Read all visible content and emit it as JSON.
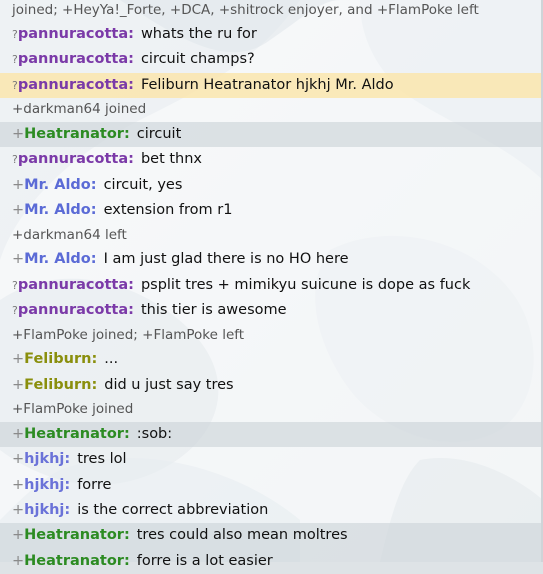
{
  "theme": {
    "pannuracotta": "#7b3aa8",
    "heatranator": "#2c8b22",
    "mraldo": "#5b6bd6",
    "feliburn": "#8a8f0d",
    "hjkhj": "#6a72d8"
  },
  "log": [
    {
      "kind": "sys",
      "text": "joined; +HeyYa!_Forte, +DCA, +shitrock enjoyer, and +FlamPoke left",
      "cls": "top"
    },
    {
      "kind": "msg",
      "rank": "?",
      "user": "pannuracotta",
      "colorKey": "pannuracotta",
      "text": "whats the ru for"
    },
    {
      "kind": "msg",
      "rank": "?",
      "user": "pannuracotta",
      "colorKey": "pannuracotta",
      "text": "circuit champs?"
    },
    {
      "kind": "msg",
      "rank": "?",
      "user": "pannuracotta",
      "colorKey": "pannuracotta",
      "text": "Feliburn Heatranator hjkhj Mr. Aldo",
      "highlight": true
    },
    {
      "kind": "sys",
      "text": "+darkman64 joined"
    },
    {
      "kind": "msg",
      "rank": "+",
      "user": "Heatranator",
      "colorKey": "heatranator",
      "text": "circuit",
      "gray": true
    },
    {
      "kind": "msg",
      "rank": "?",
      "user": "pannuracotta",
      "colorKey": "pannuracotta",
      "text": "bet thnx"
    },
    {
      "kind": "msg",
      "rank": "+",
      "user": "Mr. Aldo",
      "colorKey": "mraldo",
      "text": "circuit, yes"
    },
    {
      "kind": "msg",
      "rank": "+",
      "user": "Mr. Aldo",
      "colorKey": "mraldo",
      "text": "extension from r1"
    },
    {
      "kind": "sys",
      "text": "+darkman64 left"
    },
    {
      "kind": "msg",
      "rank": "+",
      "user": "Mr. Aldo",
      "colorKey": "mraldo",
      "text": "I am just glad there is no HO here"
    },
    {
      "kind": "msg",
      "rank": "?",
      "user": "pannuracotta",
      "colorKey": "pannuracotta",
      "text": "psplit tres + mimikyu suicune is dope as fuck"
    },
    {
      "kind": "msg",
      "rank": "?",
      "user": "pannuracotta",
      "colorKey": "pannuracotta",
      "text": "this tier is awesome"
    },
    {
      "kind": "sys",
      "text": "+FlamPoke joined; +FlamPoke left"
    },
    {
      "kind": "msg",
      "rank": "+",
      "user": "Feliburn",
      "colorKey": "feliburn",
      "text": "..."
    },
    {
      "kind": "msg",
      "rank": "+",
      "user": "Feliburn",
      "colorKey": "feliburn",
      "text": "did u just say tres"
    },
    {
      "kind": "sys",
      "text": "+FlamPoke joined"
    },
    {
      "kind": "msg",
      "rank": "+",
      "user": "Heatranator",
      "colorKey": "heatranator",
      "text": ":sob:",
      "gray": true
    },
    {
      "kind": "msg",
      "rank": "+",
      "user": "hjkhj",
      "colorKey": "hjkhj",
      "text": "tres lol"
    },
    {
      "kind": "msg",
      "rank": "+",
      "user": "hjkhj",
      "colorKey": "hjkhj",
      "text": "forre"
    },
    {
      "kind": "msg",
      "rank": "+",
      "user": "hjkhj",
      "colorKey": "hjkhj",
      "text": "is the correct abbreviation"
    },
    {
      "kind": "msg",
      "rank": "+",
      "user": "Heatranator",
      "colorKey": "heatranator",
      "text": "tres could also mean moltres",
      "gray": true
    },
    {
      "kind": "msg",
      "rank": "+",
      "user": "Heatranator",
      "colorKey": "heatranator",
      "text": "forre is a lot easier",
      "gray": true
    }
  ]
}
